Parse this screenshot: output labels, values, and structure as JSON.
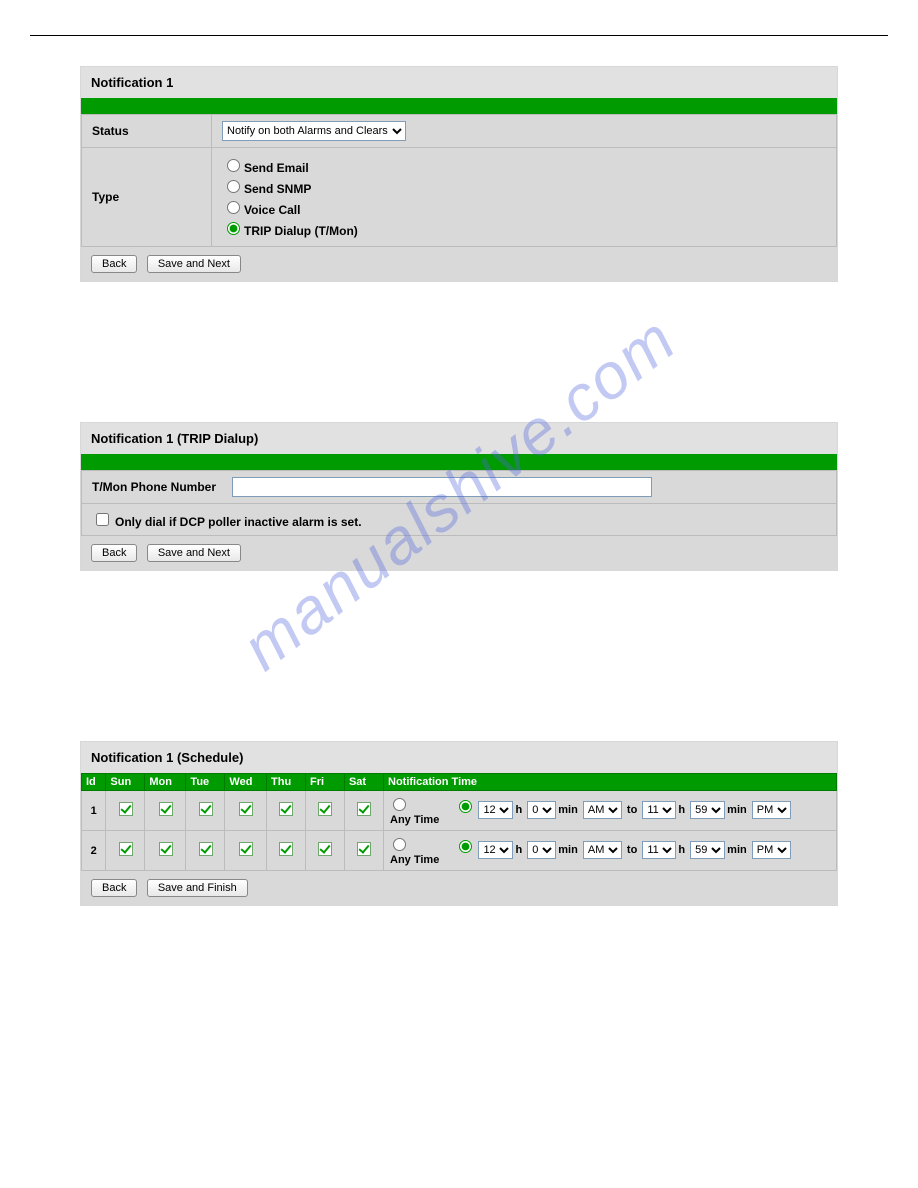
{
  "watermark": "manualshive.com",
  "panel1": {
    "title": "Notification 1",
    "status_label": "Status",
    "status_value": "Notify on both Alarms and Clears",
    "type_label": "Type",
    "types": {
      "email": "Send Email",
      "snmp": "Send SNMP",
      "voice": "Voice Call",
      "trip": "TRIP Dialup (T/Mon)"
    },
    "back": "Back",
    "save": "Save and Next"
  },
  "panel2": {
    "title": "Notification 1 (TRIP Dialup)",
    "phone_label": "T/Mon Phone Number",
    "phone_value": "",
    "only_dial": "Only dial if DCP poller inactive alarm is set.",
    "back": "Back",
    "save": "Save and Next"
  },
  "panel3": {
    "title": "Notification 1 (Schedule)",
    "headers": {
      "id": "Id",
      "sun": "Sun",
      "mon": "Mon",
      "tue": "Tue",
      "wed": "Wed",
      "thu": "Thu",
      "fri": "Fri",
      "sat": "Sat",
      "ntime": "Notification Time"
    },
    "any_time": "Any Time",
    "rows": [
      {
        "id": "1",
        "h1": "12",
        "m1": "0",
        "ap1": "AM",
        "h2": "11",
        "m2": "59",
        "ap2": "PM"
      },
      {
        "id": "2",
        "h1": "12",
        "m1": "0",
        "ap1": "AM",
        "h2": "11",
        "m2": "59",
        "ap2": "PM"
      }
    ],
    "labels": {
      "h": "h",
      "min": "min",
      "to": "to"
    },
    "back": "Back",
    "save": "Save and Finish"
  }
}
